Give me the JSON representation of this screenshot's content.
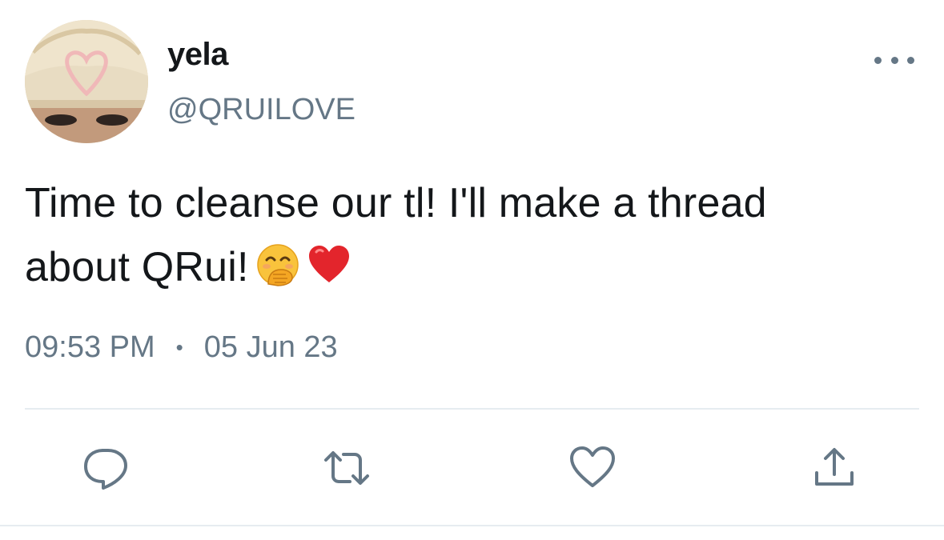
{
  "author": {
    "display_name": "yela",
    "handle": "@QRUILOVE",
    "avatar_icon": "profile-photo"
  },
  "tweet": {
    "text_line1": "Time to cleanse our tl! I'll make a thread",
    "text_line2": "about QRui!",
    "emojis": [
      "face-with-hand-over-mouth-emoji",
      "red-heart-emoji"
    ]
  },
  "meta": {
    "time": "09:53 PM",
    "separator": "•",
    "date": "05 Jun 23"
  },
  "actions": {
    "reply_icon": "reply-icon",
    "retweet_icon": "retweet-icon",
    "like_icon": "heart-icon",
    "share_icon": "share-icon"
  },
  "colors": {
    "text_primary": "#14171a",
    "text_secondary": "#657786",
    "divider": "#e6ecf0"
  }
}
